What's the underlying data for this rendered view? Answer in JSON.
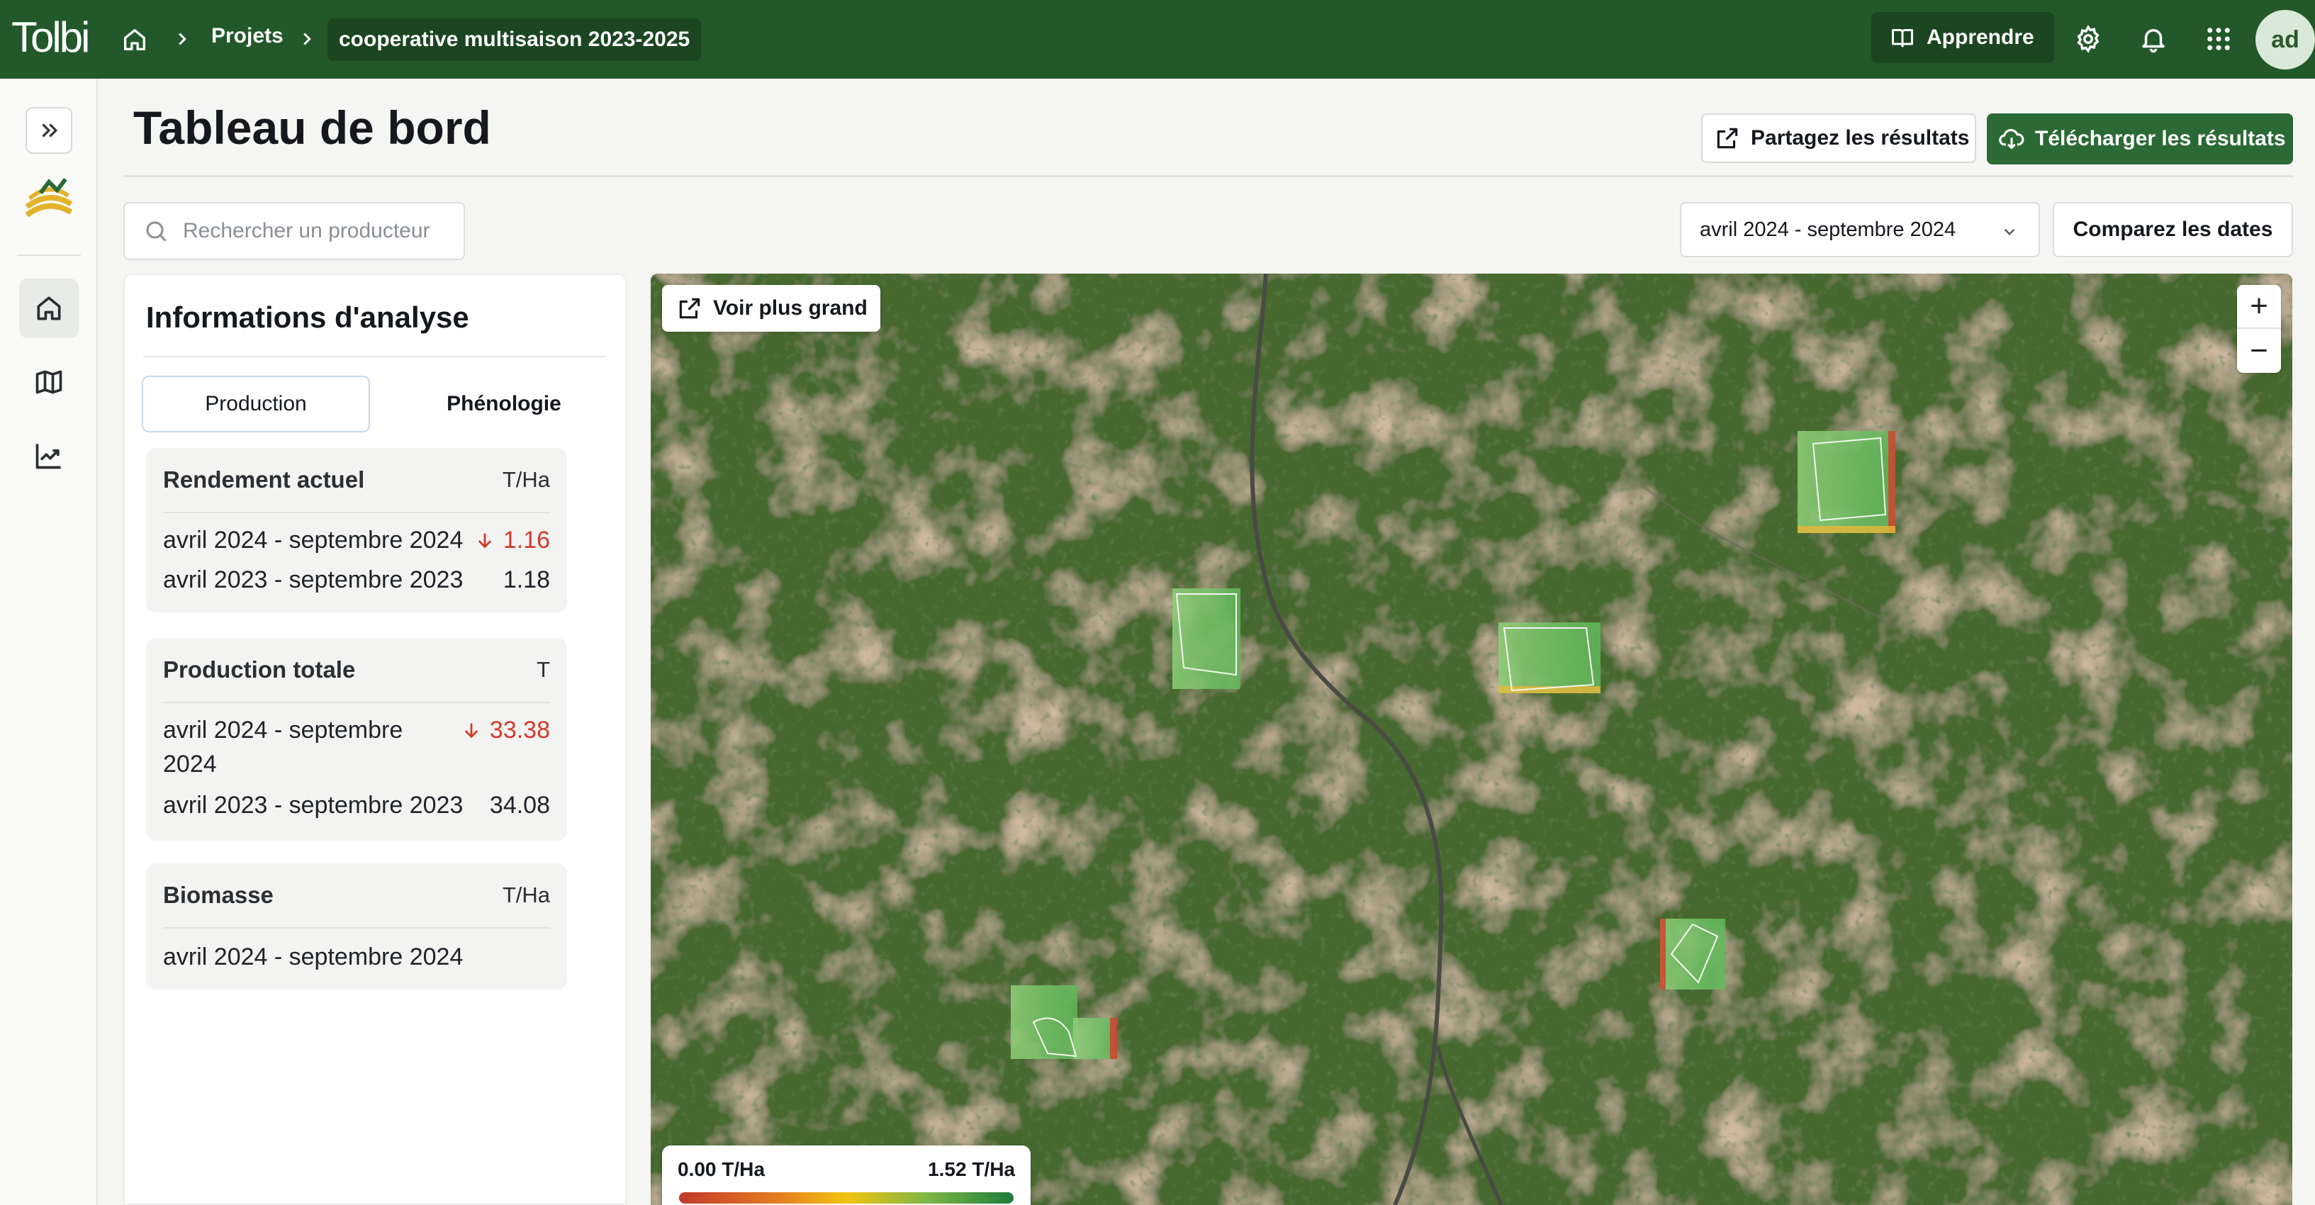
{
  "app": {
    "logo": "Tolbi"
  },
  "breadcrumb": {
    "projects": "Projets",
    "current": "cooperative multisaison 2023-2025"
  },
  "topbar": {
    "learn_label": "Apprendre",
    "avatar_initials": "ad"
  },
  "header": {
    "title": "Tableau de bord",
    "share_label": "Partagez les résultats",
    "download_label": "Télécharger les résultats"
  },
  "filters": {
    "search_placeholder": "Rechercher un producteur",
    "date_range": "avril 2024 - septembre 2024",
    "compare_label": "Comparez les dates"
  },
  "analysis": {
    "title": "Informations d'analyse",
    "tabs": [
      {
        "label": "Production",
        "active": true
      },
      {
        "label": "Phénologie",
        "active": false
      }
    ],
    "cards": [
      {
        "title": "Rendement actuel",
        "unit": "T/Ha",
        "rows": [
          {
            "period": "avril 2024 - septembre 2024",
            "value": "1.16",
            "trend": "down"
          },
          {
            "period": "avril 2023 - septembre 2023",
            "value": "1.18",
            "trend": "none"
          }
        ]
      },
      {
        "title": "Production totale",
        "unit": "T",
        "rows": [
          {
            "period": "avril 2024 - septembre 2024",
            "value": "33.38",
            "trend": "down"
          },
          {
            "period": "avril 2023 - septembre 2023",
            "value": "34.08",
            "trend": "none"
          }
        ]
      },
      {
        "title": "Biomasse",
        "unit": "T/Ha",
        "rows": [
          {
            "period": "avril 2024 - septembre 2024",
            "value": "",
            "trend": "none"
          }
        ]
      }
    ]
  },
  "map": {
    "expand_label": "Voir plus grand",
    "zoom_in": "+",
    "zoom_out": "−",
    "legend_min": "0.00 T/Ha",
    "legend_max": "1.52 T/Ha"
  },
  "colors": {
    "topbar": "#22582a",
    "primary_button": "#2b6a34",
    "trend_down": "#d23a2a"
  }
}
